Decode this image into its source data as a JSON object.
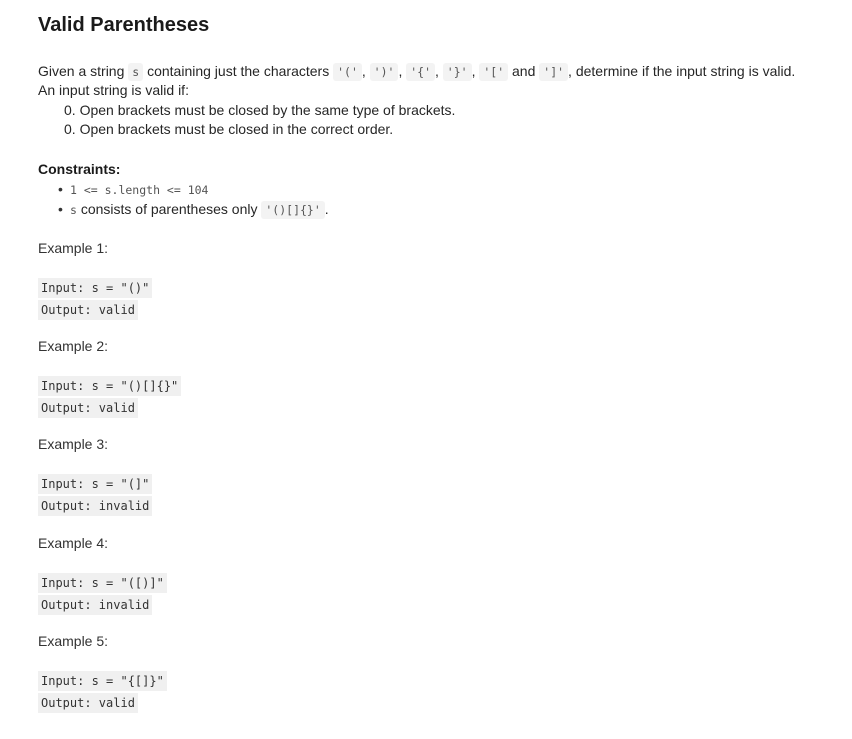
{
  "title": "Valid Parentheses",
  "description": {
    "p1_a": "Given a string",
    "p1_code_s": "s",
    "p1_b": "containing just the characters",
    "chars": [
      "'('",
      "')'",
      "'{'",
      "'}'",
      "'['",
      "']'"
    ],
    "p1_and": "and",
    "p1_c": ", determine if the input string is valid.",
    "p2": "An input string is valid if:",
    "rules": [
      "0. Open brackets must be closed by the same type of brackets.",
      "0. Open brackets must be closed in the correct order."
    ]
  },
  "constraints": {
    "title": "Constraints:",
    "c1_code": "1 <= s.length <= 104",
    "c2_code_s": "s",
    "c2_text": "consists of parentheses only",
    "c2_code": "'()[]{}'",
    "c2_end": "."
  },
  "examples": [
    {
      "title": "Example 1:",
      "input": "Input: s = \"()\"",
      "output": "Output: valid"
    },
    {
      "title": "Example 2:",
      "input": "Input: s = \"()[]{}\"",
      "output": "Output: valid"
    },
    {
      "title": "Example 3:",
      "input": "Input: s = \"(]\"",
      "output": "Output: invalid"
    },
    {
      "title": "Example 4:",
      "input": "Input: s = \"([)]\"",
      "output": "Output: invalid"
    },
    {
      "title": "Example 5:",
      "input": "Input: s = \"{[]}\"",
      "output": "Output: valid"
    }
  ]
}
